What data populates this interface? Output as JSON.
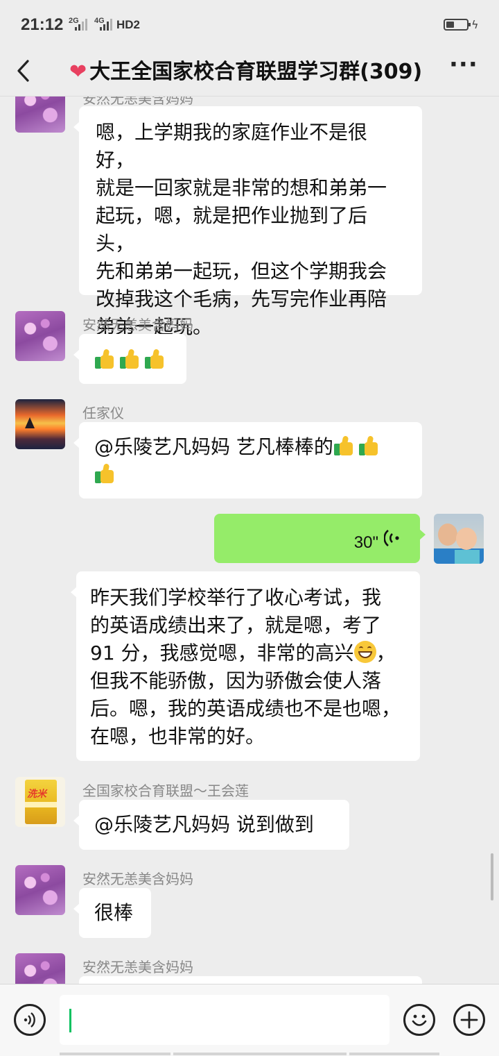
{
  "status_bar": {
    "time": "21:12",
    "network_1": "2G",
    "network_2": "4G",
    "hd": "HD2"
  },
  "header": {
    "title": "大王全国家校合育联盟学习群(309)",
    "back_icon": "chevron-left-icon",
    "more_icon": "more-dots-icon"
  },
  "messages": [
    {
      "sender": "安然无恙美含妈妈",
      "text_lines": [
        "嗯，上学期我的家庭作业不是很好，",
        "就是一回家就是非常的想和弟弟一",
        "起玩，嗯，就是把作业抛到了后头，",
        "先和弟弟一起玩，但这个学期我会",
        "改掉我这个毛病，先写完作业再陪",
        "弟弟一起玩。"
      ]
    },
    {
      "sender": "安然无恙美含妈妈",
      "emoji": "thumbs-up x3"
    },
    {
      "sender": "任家仪",
      "text": "@乐陵艺凡妈妈  艺凡棒棒的"
    },
    {
      "voice_duration": "30\""
    },
    {
      "text_lines": [
        "昨天我们学校举行了收心考试，我",
        "的英语成绩出来了，就是嗯，考了",
        "91 分，我感觉嗯，非常的高兴",
        "，",
        "但我不能骄傲，因为骄傲会使人落",
        "后。嗯，我的英语成绩也不是也嗯，",
        "在嗯，也非常的好。"
      ]
    },
    {
      "sender": "全国家校合育联盟～王会莲",
      "text": "@乐陵艺凡妈妈  说到做到"
    },
    {
      "sender": "安然无恙美含妈妈",
      "text": "很棒"
    },
    {
      "sender": "安然无恙美含妈妈"
    }
  ],
  "rice_brand": "洗米",
  "input_bar": {
    "voice_icon": "voice-input-icon",
    "emoji_icon": "emoji-icon",
    "add_icon": "plus-icon"
  }
}
